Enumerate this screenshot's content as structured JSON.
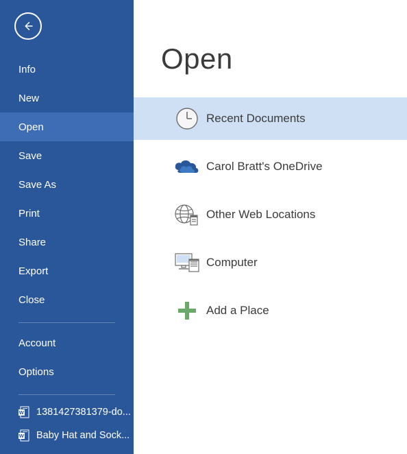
{
  "sidebar": {
    "items": [
      {
        "label": "Info",
        "selected": false
      },
      {
        "label": "New",
        "selected": false
      },
      {
        "label": "Open",
        "selected": true
      },
      {
        "label": "Save",
        "selected": false
      },
      {
        "label": "Save As",
        "selected": false
      },
      {
        "label": "Print",
        "selected": false
      },
      {
        "label": "Share",
        "selected": false
      },
      {
        "label": "Export",
        "selected": false
      },
      {
        "label": "Close",
        "selected": false
      }
    ],
    "footer": [
      {
        "label": "Account"
      },
      {
        "label": "Options"
      }
    ],
    "recent": [
      {
        "label": "1381427381379-do..."
      },
      {
        "label": "Baby Hat and Sock..."
      }
    ]
  },
  "main": {
    "title": "Open",
    "locations": [
      {
        "icon": "clock-icon",
        "label": "Recent Documents",
        "selected": true
      },
      {
        "icon": "onedrive-icon",
        "label": "Carol Bratt's OneDrive",
        "selected": false
      },
      {
        "icon": "globe-icon",
        "label": "Other Web Locations",
        "selected": false
      },
      {
        "icon": "computer-icon",
        "label": "Computer",
        "selected": false
      },
      {
        "icon": "plus-icon",
        "label": "Add a Place",
        "selected": false
      }
    ]
  }
}
